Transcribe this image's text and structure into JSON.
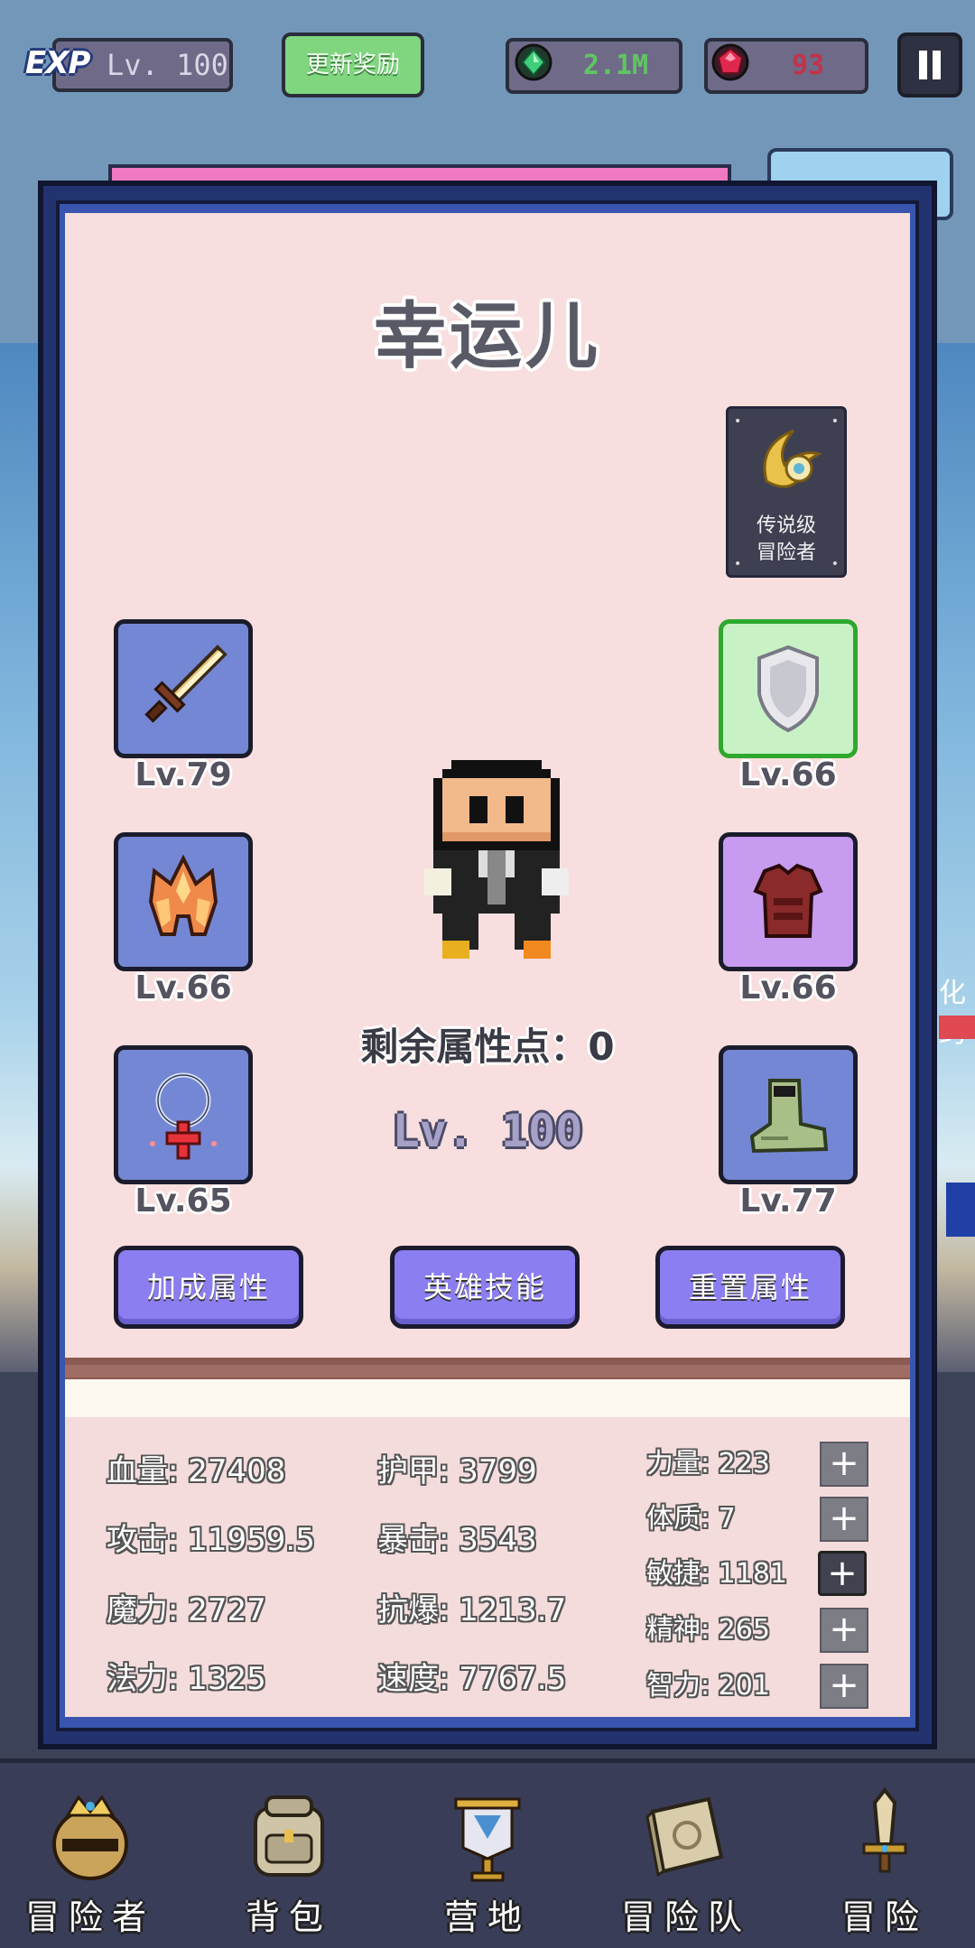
{
  "hud": {
    "exp_badge": "EXP",
    "exp_level": "Lv. 100",
    "reward_button": "更新奖励",
    "gems": "2.1M",
    "rubies": "93",
    "pause_icon": "pause-icon"
  },
  "hero": {
    "name": "幸运儿",
    "rank_line1": "传说级",
    "rank_line2": "冒险者",
    "remaining_points": "剩余属性点：0",
    "level": "Lv. 100"
  },
  "equipment": {
    "weapon": {
      "level": "Lv.79",
      "icon": "sword-icon"
    },
    "helmet": {
      "level": "Lv.66",
      "icon": "helmet-icon"
    },
    "necklace": {
      "level": "Lv.65",
      "icon": "necklace-icon"
    },
    "shield": {
      "level": "Lv.66",
      "icon": "shield-icon"
    },
    "armor": {
      "level": "Lv.66",
      "icon": "armor-icon"
    },
    "boots": {
      "level": "Lv.77",
      "icon": "boots-icon"
    }
  },
  "actions": {
    "bonus": "加成属性",
    "skills": "英雄技能",
    "reset": "重置属性"
  },
  "stats": {
    "hp": "血量: 27408",
    "attack": "攻击: 11959.5",
    "magic": "魔力: 2727",
    "mana": "法力: 1325",
    "armor": "护甲: 3799",
    "crit": "暴击: 3543",
    "crit_resist": "抗爆: 1213.7",
    "speed": "速度: 7767.5"
  },
  "attributes": {
    "strength": "力量: 223",
    "constitution": "体质: 7",
    "agility": "敏捷: 1181",
    "spirit": "精神: 265",
    "intelligence": "智力: 201",
    "plus": "+"
  },
  "nav": {
    "adventurer": "冒险者",
    "bag": "背包",
    "camp": "营地",
    "team": "冒险队",
    "adventure": "冒险"
  },
  "peek": {
    "right_text": "化约"
  },
  "colors": {
    "panel_bg": "#f8dede",
    "frame": "#23336f",
    "button": "#8b7ef0",
    "gem": "#5fc563",
    "ruby": "#c2334a"
  }
}
